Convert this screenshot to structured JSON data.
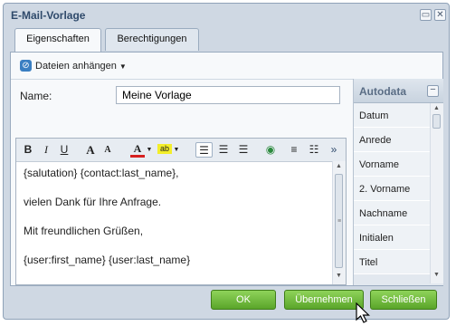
{
  "window": {
    "title": "E-Mail-Vorlage",
    "restore_icon": "restore-icon",
    "close_icon": "close-icon"
  },
  "tabs": [
    {
      "label": "Eigenschaften",
      "active": true
    },
    {
      "label": "Berechtigungen",
      "active": false
    }
  ],
  "toolbar": {
    "attach_label": "Dateien anhängen",
    "attach_icon": "paperclip-icon"
  },
  "form": {
    "name_label": "Name:",
    "name_value": "Meine Vorlage"
  },
  "editor": {
    "buttons": [
      "B",
      "I",
      "U",
      "A",
      "A",
      "A",
      "ab",
      "»"
    ],
    "content": [
      "{salutation} {contact:last_name},",
      "vielen Dank für Ihre Anfrage.",
      "Mit freundlichen Grüßen,",
      "{user:first_name} {user:last_name}"
    ]
  },
  "autodata": {
    "title": "Autodata",
    "items": [
      "Datum",
      "Anrede",
      "Vorname",
      "2. Vorname",
      "Nachname",
      "Initialen",
      "Titel"
    ]
  },
  "footer": {
    "ok_label": "OK",
    "apply_label": "Übernehmen",
    "close_label": "Schließen"
  },
  "colors": {
    "accent_green": "#6fbd3a",
    "title_blue": "#2f4a6b"
  }
}
